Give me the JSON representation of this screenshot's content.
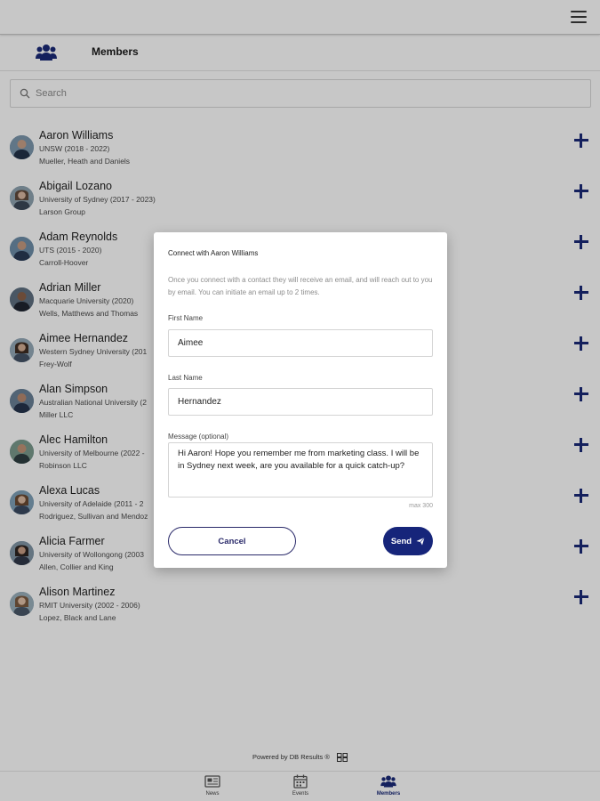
{
  "header": {
    "title": "Members"
  },
  "search": {
    "placeholder": "Search"
  },
  "members": [
    {
      "name": "Aaron Williams",
      "university": "UNSW (2018 - 2022)",
      "organization": "Mueller, Heath and Daniels"
    },
    {
      "name": "Abigail Lozano",
      "university": "University of Sydney (2017 - 2023)",
      "organization": "Larson Group"
    },
    {
      "name": "Adam Reynolds",
      "university": "UTS (2015 - 2020)",
      "organization": "Carroll-Hoover"
    },
    {
      "name": "Adrian Miller",
      "university": "Macquarie University (2020)",
      "organization": "Wells, Matthews and Thomas"
    },
    {
      "name": "Aimee Hernandez",
      "university": "Western Sydney University (201",
      "organization": "Frey-Wolf"
    },
    {
      "name": "Alan Simpson",
      "university": "Australian National University (2",
      "organization": "Miller LLC"
    },
    {
      "name": "Alec Hamilton",
      "university": "University of Melbourne (2022 -",
      "organization": "Robinson LLC"
    },
    {
      "name": "Alexa Lucas",
      "university": "University of Adelaide (2011 - 2",
      "organization": "Rodriguez, Sullivan and Mendoz"
    },
    {
      "name": "Alicia Farmer",
      "university": "University of Wollongong (2003",
      "organization": "Allen, Collier and King"
    },
    {
      "name": "Alison Martinez",
      "university": "RMIT University (2002 - 2006)",
      "organization": "Lopez, Black and Lane"
    }
  ],
  "footer": {
    "powered_by": "Powered by DB Results ®"
  },
  "nav": [
    {
      "label": "News"
    },
    {
      "label": "Events"
    },
    {
      "label": "Members"
    }
  ],
  "dialog": {
    "title": "Connect with Aaron Williams",
    "description": "Once you connect with a contact they will receive an email, and will reach out to you by email. You can initiate an email up to 2 times.",
    "first_name_label": "First Name",
    "first_name_value": "Aimee",
    "last_name_label": "Last Name",
    "last_name_value": "Hernandez",
    "message_label": "Message (optional)",
    "message_value": "Hi Aaron! Hope you remember me from marketing class. I will be in Sydney next week, are you available for a quick catch-up?",
    "max_hint": "max 300",
    "cancel_label": "Cancel",
    "send_label": "Send"
  },
  "colors": {
    "accent": "#16257a",
    "plus": "#1a2a78"
  },
  "icons": {
    "menu": "hamburger-icon",
    "members": "members-group-icon",
    "search": "search-icon",
    "add": "plus-icon",
    "send": "paper-plane-icon",
    "news": "newspaper-icon",
    "events": "calendar-icon"
  }
}
